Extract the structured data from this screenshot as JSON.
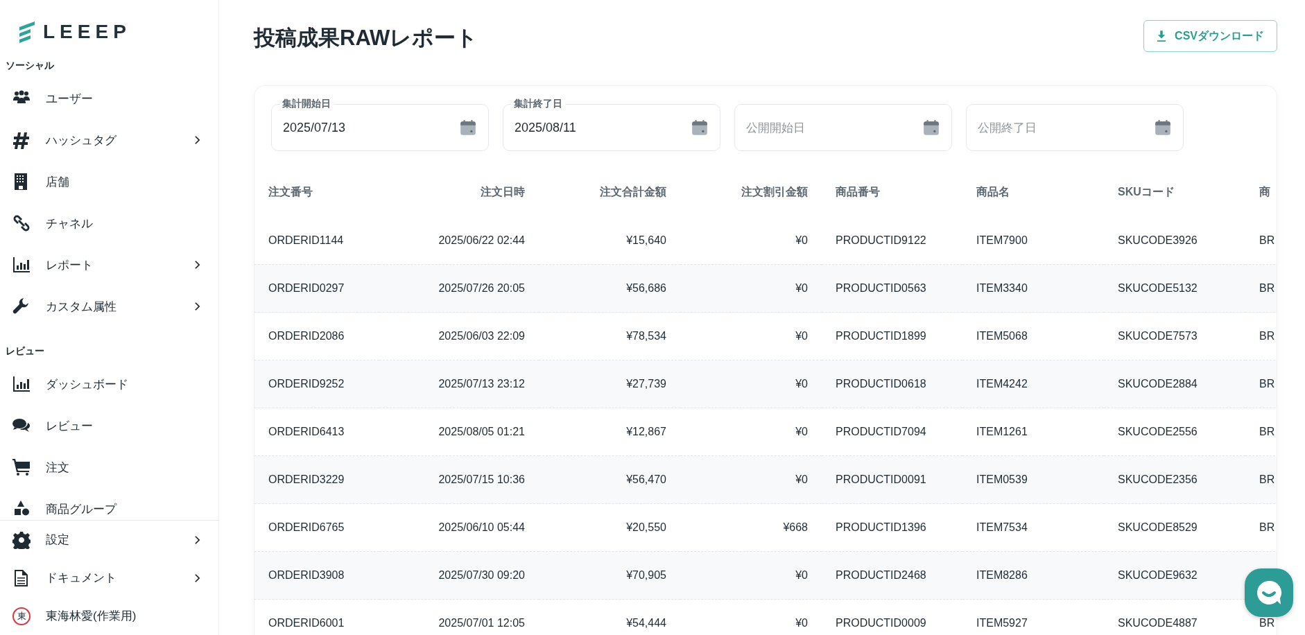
{
  "logo": {
    "text": "LEEEP"
  },
  "sidebar": {
    "sections": [
      {
        "title": "ソーシャル",
        "items": [
          {
            "label": "ユーザー",
            "expandable": false
          },
          {
            "label": "ハッシュタグ",
            "expandable": true
          },
          {
            "label": "店舗",
            "expandable": false
          },
          {
            "label": "チャネル",
            "expandable": false
          },
          {
            "label": "レポート",
            "expandable": true
          },
          {
            "label": "カスタム属性",
            "expandable": true
          }
        ]
      },
      {
        "title": "レビュー",
        "items": [
          {
            "label": "ダッシュボード",
            "expandable": false
          },
          {
            "label": "レビュー",
            "expandable": false
          },
          {
            "label": "注文",
            "expandable": false
          },
          {
            "label": "商品グループ",
            "expandable": false
          }
        ]
      }
    ],
    "footer": [
      {
        "label": "設定",
        "expandable": true
      },
      {
        "label": "ドキュメント",
        "expandable": true
      }
    ],
    "user": {
      "avatar_text": "東",
      "name": "東海林愛(作業用)"
    }
  },
  "page": {
    "title": "投稿成果RAWレポート",
    "download_button": "CSVダウンロード"
  },
  "filters": [
    {
      "label": "集計開始日",
      "value": "2025/07/13"
    },
    {
      "label": "集計終了日",
      "value": "2025/08/11"
    },
    {
      "placeholder": "公開開始日"
    },
    {
      "placeholder": "公開終了日"
    }
  ],
  "table": {
    "columns": [
      "注文番号",
      "注文日時",
      "注文合計金額",
      "注文割引金額",
      "商品番号",
      "商品名",
      "SKUコード",
      "商"
    ],
    "rows": [
      [
        "ORDERID1144",
        "2025/06/22 02:44",
        "¥15,640",
        "¥0",
        "PRODUCTID9122",
        "ITEM7900",
        "SKUCODE3926",
        "BR"
      ],
      [
        "ORDERID0297",
        "2025/07/26 20:05",
        "¥56,686",
        "¥0",
        "PRODUCTID0563",
        "ITEM3340",
        "SKUCODE5132",
        "BR"
      ],
      [
        "ORDERID2086",
        "2025/06/03 22:09",
        "¥78,534",
        "¥0",
        "PRODUCTID1899",
        "ITEM5068",
        "SKUCODE7573",
        "BR"
      ],
      [
        "ORDERID9252",
        "2025/07/13 23:12",
        "¥27,739",
        "¥0",
        "PRODUCTID0618",
        "ITEM4242",
        "SKUCODE2884",
        "BR"
      ],
      [
        "ORDERID6413",
        "2025/08/05 01:21",
        "¥12,867",
        "¥0",
        "PRODUCTID7094",
        "ITEM1261",
        "SKUCODE2556",
        "BR"
      ],
      [
        "ORDERID3229",
        "2025/07/15 10:36",
        "¥56,470",
        "¥0",
        "PRODUCTID0091",
        "ITEM0539",
        "SKUCODE2356",
        "BR"
      ],
      [
        "ORDERID6765",
        "2025/06/10 05:44",
        "¥20,550",
        "¥668",
        "PRODUCTID1396",
        "ITEM7534",
        "SKUCODE8529",
        "BR"
      ],
      [
        "ORDERID3908",
        "2025/07/30 09:20",
        "¥70,905",
        "¥0",
        "PRODUCTID2468",
        "ITEM8286",
        "SKUCODE9632"
      ],
      [
        "ORDERID6001",
        "2025/07/01 12:05",
        "¥54,444",
        "¥0",
        "PRODUCTID0009",
        "ITEM5927",
        "SKUCODE4887",
        "BR"
      ]
    ]
  }
}
